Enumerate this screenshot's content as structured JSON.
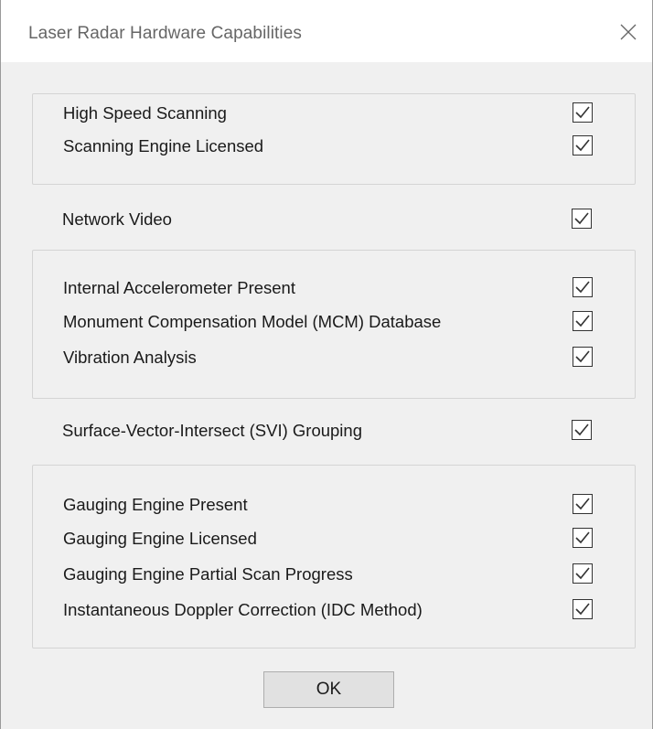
{
  "window": {
    "title": "Laser Radar Hardware Capabilities",
    "close_icon": "close-icon"
  },
  "groups": [
    {
      "items": [
        {
          "label": "High Speed Scanning",
          "checked": true
        },
        {
          "label": "Scanning Engine Licensed",
          "checked": true
        }
      ]
    },
    {
      "items": [
        {
          "label": "Network Video",
          "checked": true
        }
      ]
    },
    {
      "items": [
        {
          "label": "Internal Accelerometer Present",
          "checked": true
        },
        {
          "label": "Monument Compensation Model (MCM) Database",
          "checked": true
        },
        {
          "label": "Vibration Analysis",
          "checked": true
        }
      ]
    },
    {
      "items": [
        {
          "label": "Surface-Vector-Intersect (SVI) Grouping",
          "checked": true
        }
      ]
    },
    {
      "items": [
        {
          "label": "Gauging Engine Present",
          "checked": true
        },
        {
          "label": "Gauging Engine Licensed",
          "checked": true
        },
        {
          "label": "Gauging Engine Partial Scan Progress",
          "checked": true
        },
        {
          "label": "Instantaneous Doppler Correction (IDC Method)",
          "checked": true
        }
      ]
    }
  ],
  "buttons": {
    "ok_label": "OK"
  }
}
